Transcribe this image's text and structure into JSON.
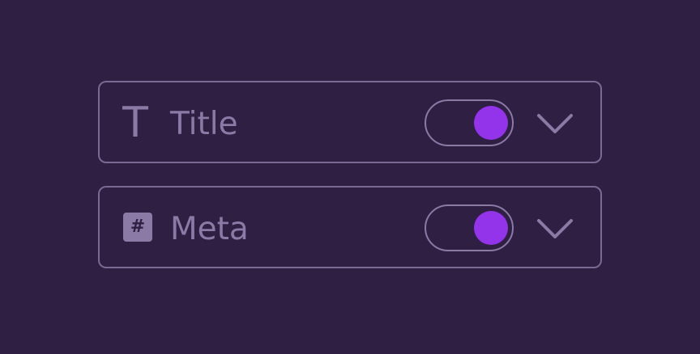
{
  "colors": {
    "background": "#2e1f43",
    "border": "#7a6895",
    "text": "#8b7aa6",
    "toggle_on": "#9333ea"
  },
  "rows": [
    {
      "label": "Title",
      "icon": "text-type-icon",
      "icon_glyph": "T",
      "toggle_on": true,
      "chevron_icon": "chevron-down-icon"
    },
    {
      "label": "Meta",
      "icon": "hash-icon",
      "icon_glyph": "#",
      "toggle_on": true,
      "chevron_icon": "chevron-down-icon"
    }
  ]
}
